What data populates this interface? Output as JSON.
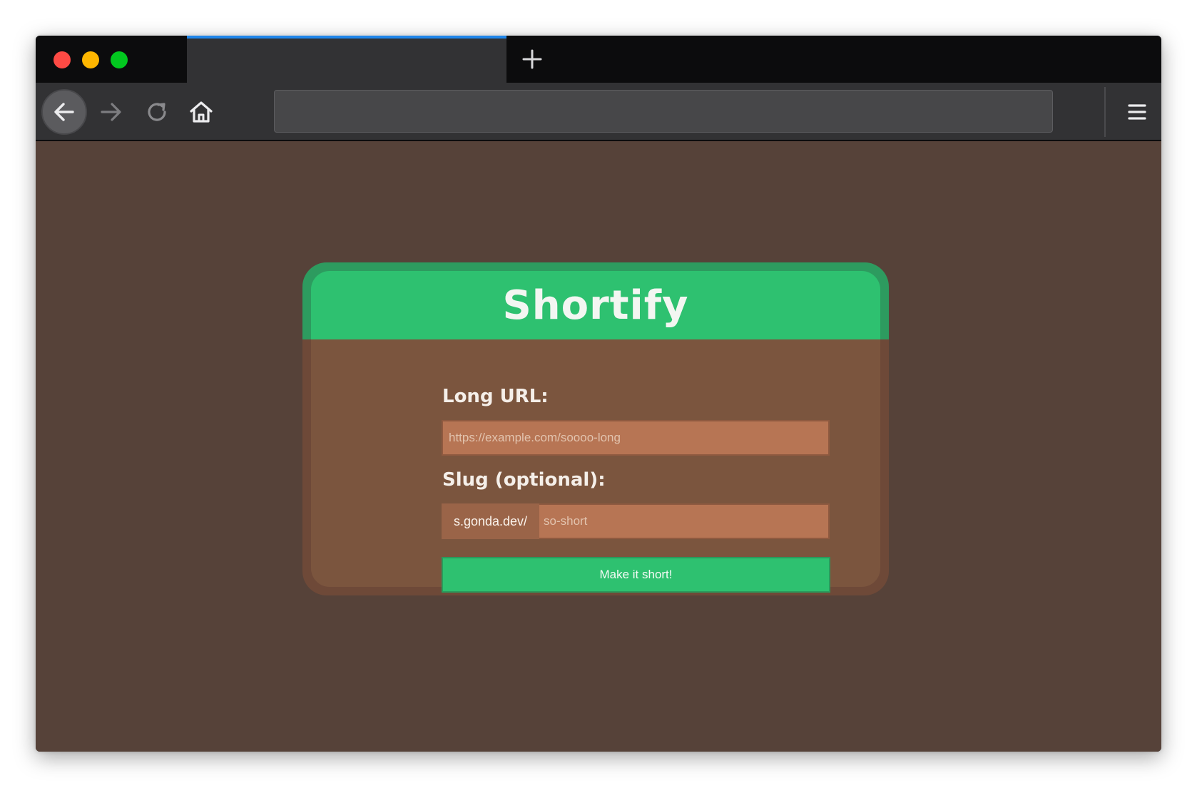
{
  "browser": {
    "window_controls": {
      "close_color": "#fe4a44",
      "minimize_color": "#feb600",
      "maximize_color": "#02c81f"
    },
    "tab": {
      "title": "",
      "active_indicator_color": "#1f86e9"
    },
    "new_tab_icon": "plus-icon",
    "nav": {
      "back_icon": "arrow-left-icon",
      "forward_icon": "arrow-right-icon",
      "reload_icon": "reload-icon",
      "home_icon": "home-icon",
      "menu_icon": "hamburger-menu-icon"
    },
    "address_bar": {
      "value": ""
    }
  },
  "page": {
    "background_color": "#564239",
    "card": {
      "title": "Shortify",
      "header_color": "#2ec170",
      "long_url": {
        "label": "Long URL:",
        "value": "",
        "placeholder": "https://example.com/soooo-long"
      },
      "slug": {
        "label": "Slug (optional):",
        "prefix": "s.gonda.dev/",
        "value": "",
        "placeholder": "so-short"
      },
      "submit_label": "Make it short!"
    }
  }
}
